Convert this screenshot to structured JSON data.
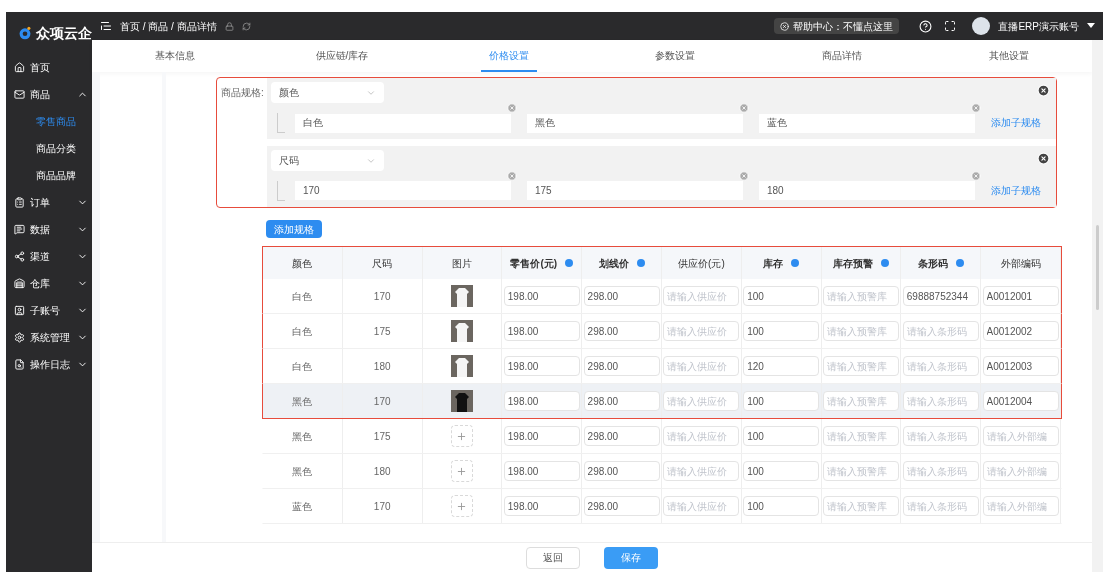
{
  "header": {
    "logo_text": "众项云企",
    "breadcrumb": "首页 / 商品 / 商品详情",
    "help": "帮助中心：不懂点这里",
    "account": "直播ERP演示账号"
  },
  "sidebar": {
    "items": [
      {
        "label": "首页"
      },
      {
        "label": "商品",
        "expanded": true,
        "children": [
          {
            "label": "零售商品",
            "selected": true
          },
          {
            "label": "商品分类",
            "selected": false
          },
          {
            "label": "商品品牌",
            "selected": false
          }
        ]
      },
      {
        "label": "订单",
        "expanded": false
      },
      {
        "label": "数据",
        "expanded": false
      },
      {
        "label": "渠道",
        "expanded": false
      },
      {
        "label": "仓库",
        "expanded": false
      },
      {
        "label": "子账号",
        "expanded": false
      },
      {
        "label": "系统管理",
        "expanded": false
      },
      {
        "label": "操作日志",
        "expanded": false
      }
    ]
  },
  "tabs": [
    {
      "label": "基本信息",
      "selected": false
    },
    {
      "label": "供应链/库存",
      "selected": false
    },
    {
      "label": "价格设置",
      "selected": true
    },
    {
      "label": "参数设置",
      "selected": false
    },
    {
      "label": "商品详情",
      "selected": false
    },
    {
      "label": "其他设置",
      "selected": false
    }
  ],
  "spec_section": {
    "label": "商品规格:",
    "highlight_frame": true,
    "add_spec_button": "添加规格",
    "groups": [
      {
        "name": "颜色",
        "values": [
          "白色",
          "黑色",
          "蓝色"
        ],
        "add_link": "添加子规格"
      },
      {
        "name": "尺码",
        "values": [
          "170",
          "175",
          "180"
        ],
        "add_link": "添加子规格"
      }
    ]
  },
  "table": {
    "columns": [
      {
        "label": "颜色",
        "bold": false,
        "info": false
      },
      {
        "label": "尺码",
        "bold": false,
        "info": false
      },
      {
        "label": "图片",
        "bold": false,
        "info": false
      },
      {
        "label": "零售价(元)",
        "bold": true,
        "info": true
      },
      {
        "label": "划线价",
        "bold": true,
        "info": true
      },
      {
        "label": "供应价(元)",
        "bold": false,
        "info": false
      },
      {
        "label": "库存",
        "bold": true,
        "info": true
      },
      {
        "label": "库存预警",
        "bold": true,
        "info": true
      },
      {
        "label": "条形码",
        "bold": true,
        "info": true
      },
      {
        "label": "外部编码",
        "bold": false,
        "info": false
      }
    ],
    "rows": [
      {
        "cells": [
          "白色",
          "170"
        ],
        "kind": "light",
        "hovered": false,
        "in_frame": true,
        "inputs": [
          {
            "value": "198.00"
          },
          {
            "value": "298.00"
          },
          {
            "placeholder": "请输入供应价"
          },
          {
            "value": "100"
          },
          {
            "placeholder": "请输入预警库"
          },
          {
            "value": "69888752344"
          },
          {
            "value": "A0012001"
          }
        ]
      },
      {
        "cells": [
          "白色",
          "175"
        ],
        "kind": "light",
        "hovered": false,
        "in_frame": true,
        "inputs": [
          {
            "value": "198.00"
          },
          {
            "value": "298.00"
          },
          {
            "placeholder": "请输入供应价"
          },
          {
            "value": "100"
          },
          {
            "placeholder": "请输入预警库"
          },
          {
            "placeholder": "请输入条形码"
          },
          {
            "value": "A0012002"
          }
        ]
      },
      {
        "cells": [
          "白色",
          "180"
        ],
        "kind": "light",
        "hovered": false,
        "in_frame": true,
        "inputs": [
          {
            "value": "198.00"
          },
          {
            "value": "298.00"
          },
          {
            "placeholder": "请输入供应价"
          },
          {
            "value": "120"
          },
          {
            "placeholder": "请输入预警库"
          },
          {
            "placeholder": "请输入条形码"
          },
          {
            "value": "A0012003"
          }
        ]
      },
      {
        "cells": [
          "黑色",
          "170"
        ],
        "kind": "dark",
        "hovered": true,
        "in_frame": true,
        "inputs": [
          {
            "value": "198.00"
          },
          {
            "value": "298.00"
          },
          {
            "placeholder": "请输入供应价"
          },
          {
            "value": "100"
          },
          {
            "placeholder": "请输入预警库"
          },
          {
            "placeholder": "请输入条形码"
          },
          {
            "value": "A0012004"
          }
        ]
      },
      {
        "cells": [
          "黑色",
          "175"
        ],
        "kind": "upload",
        "hovered": false,
        "in_frame": false,
        "inputs": [
          {
            "value": "198.00"
          },
          {
            "value": "298.00"
          },
          {
            "placeholder": "请输入供应价"
          },
          {
            "value": "100"
          },
          {
            "placeholder": "请输入预警库"
          },
          {
            "placeholder": "请输入条形码"
          },
          {
            "placeholder": "请输入外部编"
          }
        ]
      },
      {
        "cells": [
          "黑色",
          "180"
        ],
        "kind": "upload",
        "hovered": false,
        "in_frame": false,
        "inputs": [
          {
            "value": "198.00"
          },
          {
            "value": "298.00"
          },
          {
            "placeholder": "请输入供应价"
          },
          {
            "value": "100"
          },
          {
            "placeholder": "请输入预警库"
          },
          {
            "placeholder": "请输入条形码"
          },
          {
            "placeholder": "请输入外部编"
          }
        ]
      },
      {
        "cells": [
          "蓝色",
          "170"
        ],
        "kind": "upload",
        "hovered": false,
        "in_frame": false,
        "inputs": [
          {
            "value": "198.00"
          },
          {
            "value": "298.00"
          },
          {
            "placeholder": "请输入供应价"
          },
          {
            "value": "100"
          },
          {
            "placeholder": "请输入预警库"
          },
          {
            "placeholder": "请输入条形码"
          },
          {
            "placeholder": "请输入外部编"
          }
        ]
      }
    ]
  },
  "footer": {
    "buttons": [
      {
        "label": "返回",
        "kind": "default"
      },
      {
        "label": "保存",
        "kind": "primary"
      }
    ]
  }
}
